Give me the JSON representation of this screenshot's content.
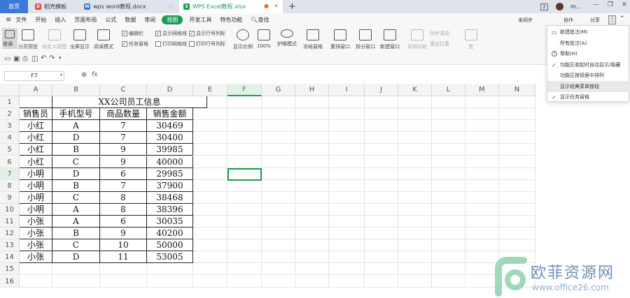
{
  "tabs": [
    {
      "label": "首页",
      "active": true
    },
    {
      "label": "稻壳模板",
      "icon": "D"
    },
    {
      "label": "wps word教程.docx",
      "icon": "W"
    },
    {
      "label": "WPS Excel教程.xlsx",
      "icon": "S"
    }
  ],
  "tab_extra": {
    "count": "2",
    "user": "m..."
  },
  "menu": [
    "文件",
    "开始",
    "插入",
    "页面布局",
    "公式",
    "数据",
    "审阅",
    "视图",
    "开发工具",
    "特色功能",
    "查找"
  ],
  "menu_right": {
    "sync": "未同步",
    "collab": "协作",
    "share": "分享"
  },
  "toolbar": {
    "normal": "普通",
    "pagebreak": "分页预览",
    "custom_view": "自定义视图",
    "fullscreen": "全屏显示",
    "read_mode": "阅读模式",
    "edit_bar": "编辑栏",
    "task_pane": "任务窗格",
    "show_grid": "显示网格线",
    "print_grid": "打印网格线",
    "show_headers": "显示行号列标",
    "print_headers": "打印行号列标",
    "zoom": "显示比例",
    "zoom100": "100%",
    "eye": "护眼模式",
    "freeze": "冻结窗格",
    "rearrange": "重排窗口",
    "split": "拆分窗口",
    "new_window": "新建窗口",
    "side_by_side": "并排比较",
    "sync_scroll": "同步滚动",
    "reset_pos": "重设位置",
    "macro": "宏"
  },
  "formula": {
    "cell": "F7",
    "fx": "fx"
  },
  "columns": [
    "A",
    "B",
    "C",
    "D",
    "E",
    "F",
    "G",
    "H",
    "I",
    "J",
    "K",
    "L",
    "M",
    "N"
  ],
  "rows": [
    "1",
    "2",
    "3",
    "4",
    "5",
    "6",
    "7",
    "8",
    "9",
    "10",
    "11",
    "12",
    "13",
    "14",
    "15",
    "16"
  ],
  "sheet": {
    "title": "XX公司员工信息",
    "headers": [
      "销售员",
      "手机型号",
      "商品数量",
      "销售金额"
    ],
    "data": [
      [
        "小红",
        "A",
        "7",
        "30469"
      ],
      [
        "小红",
        "D",
        "7",
        "30400"
      ],
      [
        "小红",
        "B",
        "9",
        "39985"
      ],
      [
        "小红",
        "C",
        "9",
        "40000"
      ],
      [
        "小明",
        "D",
        "6",
        "29985"
      ],
      [
        "小明",
        "B",
        "7",
        "37900"
      ],
      [
        "小明",
        "C",
        "8",
        "38468"
      ],
      [
        "小明",
        "A",
        "8",
        "38396"
      ],
      [
        "小张",
        "A",
        "6",
        "30035"
      ],
      [
        "小张",
        "B",
        "9",
        "40200"
      ],
      [
        "小张",
        "C",
        "10",
        "50000"
      ],
      [
        "小张",
        "D",
        "11",
        "53005"
      ]
    ]
  },
  "dropdown": [
    {
      "label": "新建批注(M)",
      "icon": "note-icon"
    },
    {
      "label": "所有批注(A)",
      "icon": ""
    },
    {
      "label": "帮助(H)",
      "icon": "help-icon"
    },
    {
      "label": "功能区收起时自动显示/隐藏",
      "icon": "check"
    },
    {
      "label": "功能区按钮居中排列",
      "icon": ""
    },
    {
      "label": "显示经典菜单按钮",
      "icon": "",
      "highlight": true
    },
    {
      "label": "显示任务窗格",
      "icon": "check"
    }
  ],
  "watermark": {
    "text": "欧菲资源网",
    "url": "www.office26.com"
  },
  "colors": {
    "accent": "#1e9b52",
    "tabbar": "#dfe4ec",
    "active_tab": "#3c78d8"
  }
}
